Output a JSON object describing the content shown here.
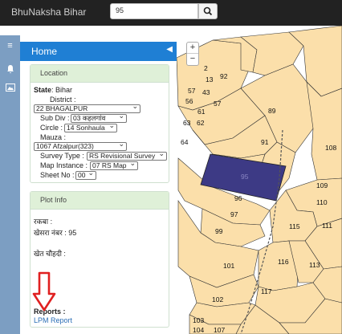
{
  "header": {
    "brand": "BhuNaksha Bihar",
    "search_value": "95"
  },
  "panel": {
    "title": "Home",
    "location": {
      "heading": "Location",
      "state_label": "State",
      "state_value": ": Bihar",
      "district_label": "District :",
      "district_value": "22 BHAGALPUR",
      "subdiv_label": "Sub Div :",
      "subdiv_value": "03 कहलगांव",
      "circle_label": "Circle :",
      "circle_value": "14 Sonhaula",
      "mauza_label": "Mauza :",
      "mauza_value": "1067 Afzalpur(323)",
      "survey_label": "Survey Type :",
      "survey_value": "RS Revisional Survey",
      "map_label": "Map Instance :",
      "map_value": "07 RS Map",
      "sheet_label": "Sheet No :",
      "sheet_value": "00"
    },
    "plot_info": {
      "heading": "Plot Info",
      "rakba": "रकबा :",
      "khesra": "खेसरा नंबर : 95",
      "khet": "खेत चौहदी :",
      "reports_label": "Reports :",
      "report_link": "LPM Report"
    }
  },
  "map": {
    "plots": [
      "1",
      "2",
      "13",
      "57",
      "56",
      "43",
      "57",
      "61",
      "63",
      "62",
      "64",
      "92",
      "91",
      "89",
      "108",
      "95",
      "96",
      "109",
      "110",
      "97",
      "115",
      "111",
      "99",
      "116",
      "113",
      "101",
      "117",
      "102",
      "103",
      "104",
      "107"
    ],
    "zoom_in": "+",
    "zoom_out": "−"
  },
  "colors": {
    "parcel": "#fbdfaa",
    "selected": "#3d3a85",
    "header": "#222222",
    "panel_head": "#1f7fd4"
  }
}
